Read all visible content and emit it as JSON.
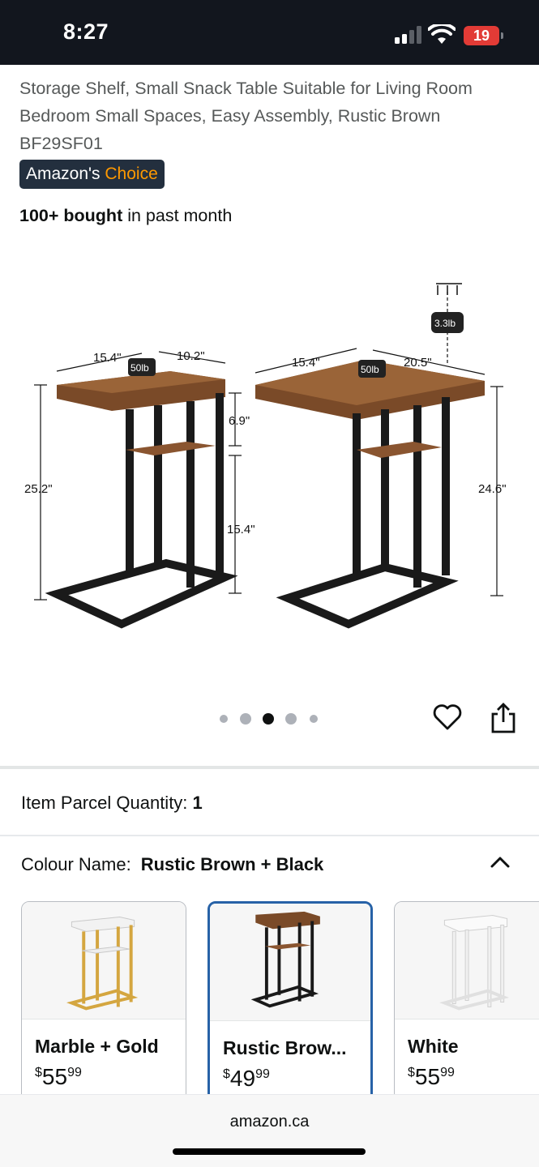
{
  "status_bar": {
    "time": "8:27",
    "battery": "19"
  },
  "product": {
    "title_lines": [
      "Storage Shelf, Small Snack Table Suitable for Living Room",
      "Bedroom Small Spaces, Easy Assembly, Rustic Brown",
      "BF29SF01"
    ],
    "badge": {
      "prefix": "Amazon's",
      "suffix": " Choice"
    },
    "bought": {
      "count": "100+ bought",
      "suffix": " in past month"
    }
  },
  "image_labels": {
    "left_width": "15.4\"",
    "left_depth": "10.2\"",
    "left_load": "50lb",
    "left_height": "25.2\"",
    "left_gap": "6.9\"",
    "left_lower": "15.4\"",
    "right_width": "15.4\"",
    "right_depth": "20.5\"",
    "right_load": "50lb",
    "right_top_load": "3.3lb",
    "right_height": "24.6\""
  },
  "carousel": {
    "count": 5,
    "active_index": 2
  },
  "details": {
    "parcel_label": "Item Parcel Quantity:",
    "parcel_value": "1",
    "colour_label": "Colour Name:",
    "colour_value": "Rustic Brown + Black"
  },
  "swatches": [
    {
      "name": "Marble + Gold",
      "currency": "$",
      "dollars": "55",
      "cents": "99",
      "selected": false
    },
    {
      "name": "Rustic Brow...",
      "currency": "$",
      "dollars": "49",
      "cents": "99",
      "selected": true
    },
    {
      "name": "White",
      "currency": "$",
      "dollars": "55",
      "cents": "99",
      "selected": false
    }
  ],
  "footer": {
    "domain": "amazon.ca"
  },
  "colors": {
    "accent_blue": "#2762a7",
    "badge_bg": "#232f3e",
    "badge_orange": "#ff9900",
    "wood": "#7a4a28"
  }
}
